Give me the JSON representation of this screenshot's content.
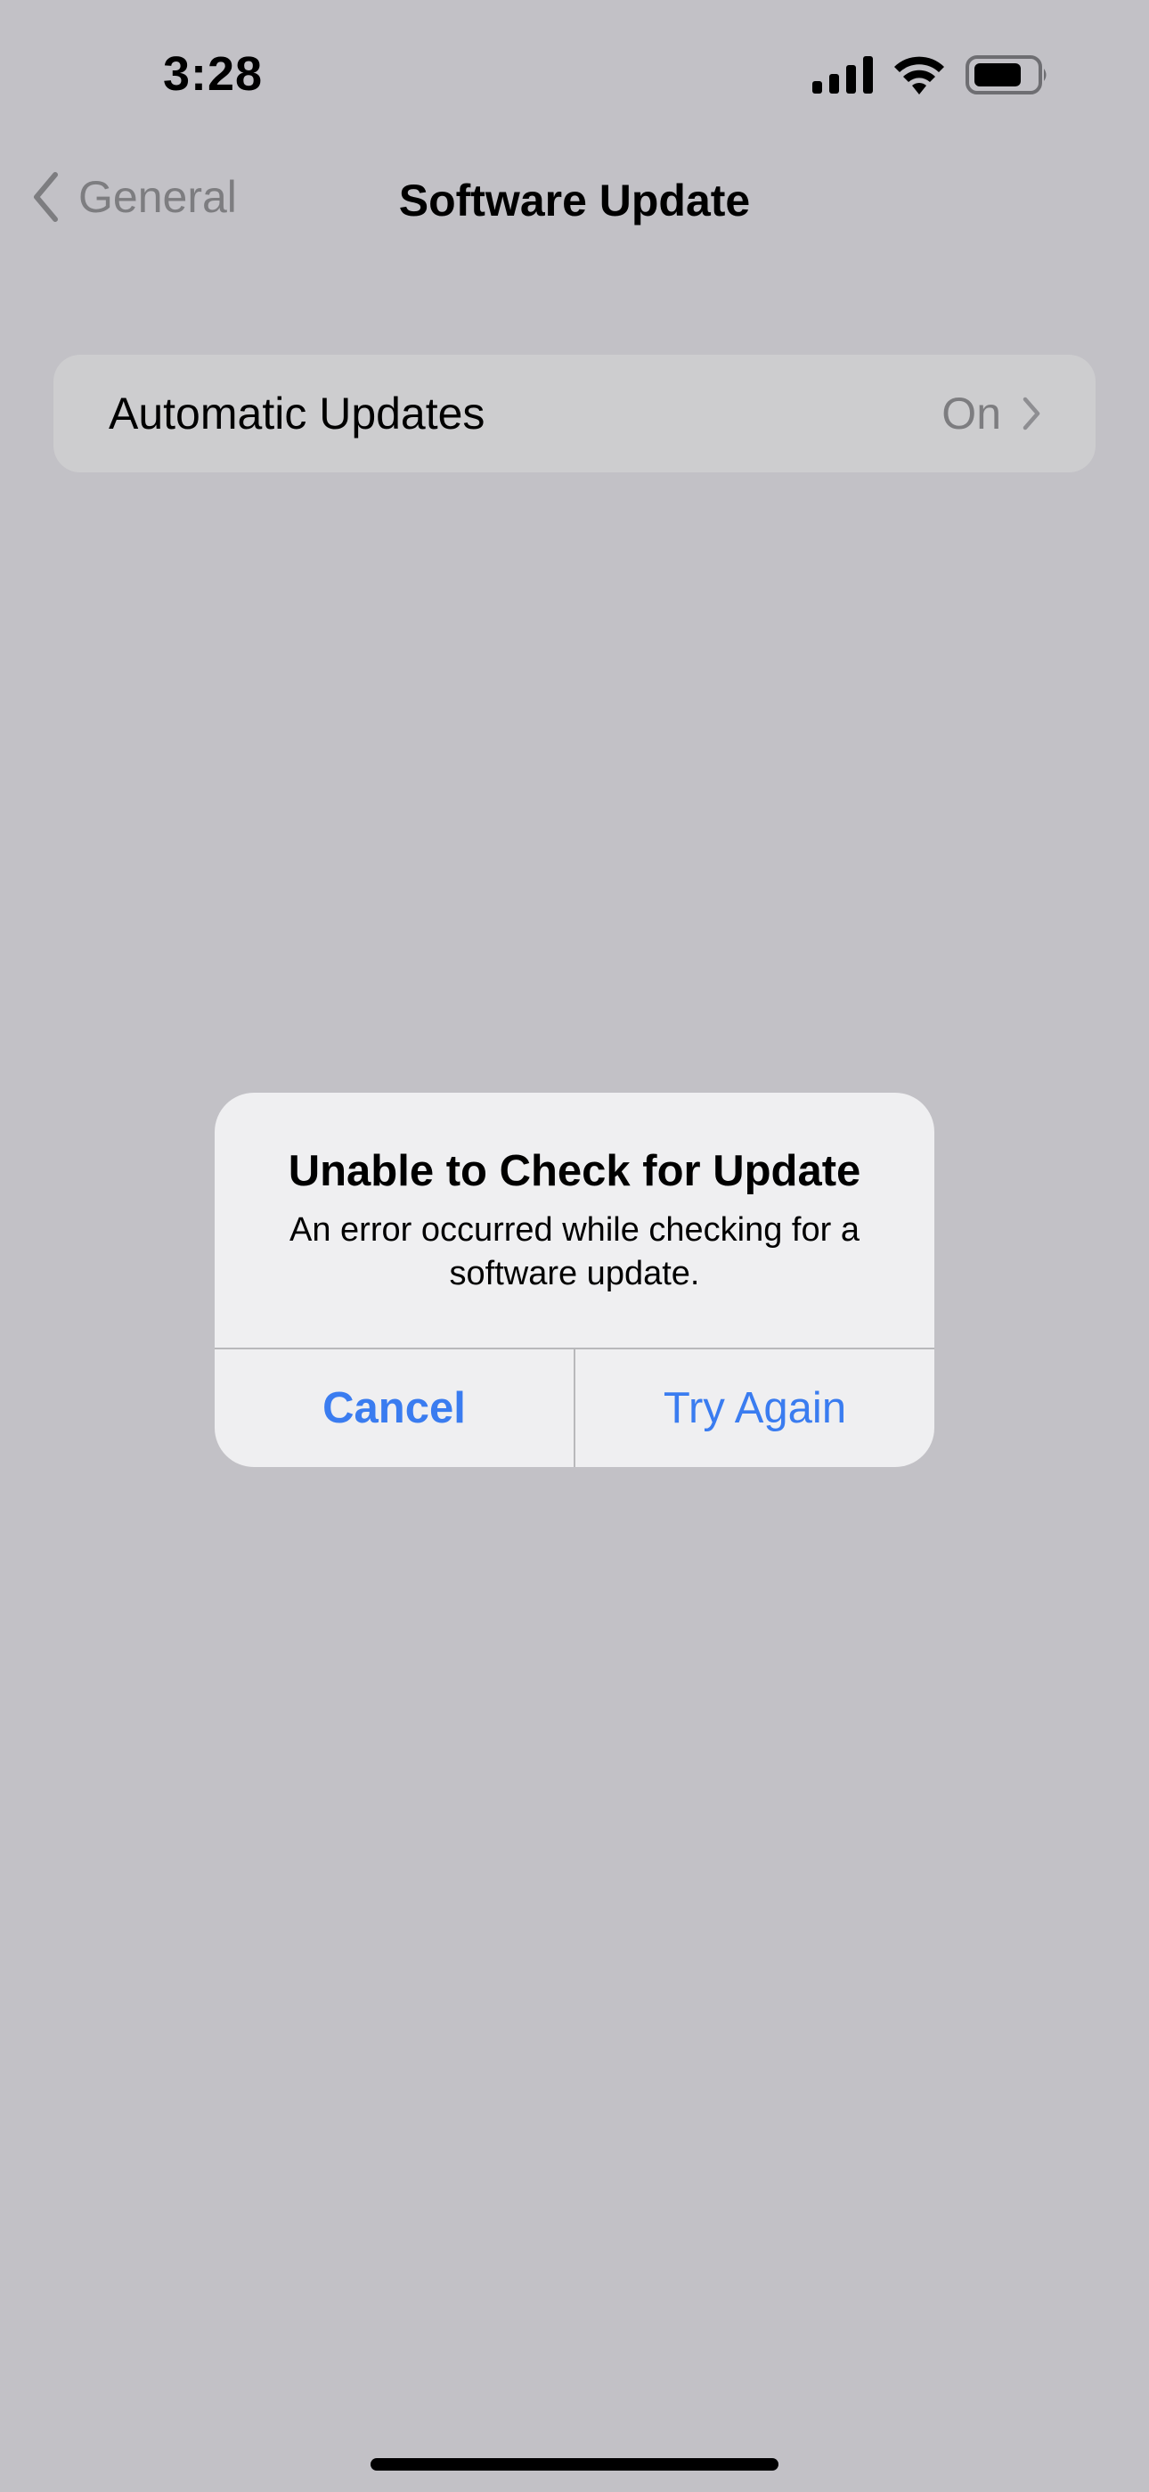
{
  "status_bar": {
    "time": "3:28",
    "icons": [
      "cellular-signal-icon",
      "wifi-icon",
      "battery-icon"
    ]
  },
  "nav": {
    "back_label": "General",
    "title": "Software Update"
  },
  "settings": {
    "automatic_updates": {
      "label": "Automatic Updates",
      "value": "On"
    }
  },
  "alert": {
    "title": "Unable to Check for Update",
    "message": "An error occurred while checking for a software update.",
    "cancel_label": "Cancel",
    "retry_label": "Try Again"
  },
  "colors": {
    "background": "#c2c1c6",
    "accent": "#3a7cf0",
    "dialog": "#efeff1"
  }
}
